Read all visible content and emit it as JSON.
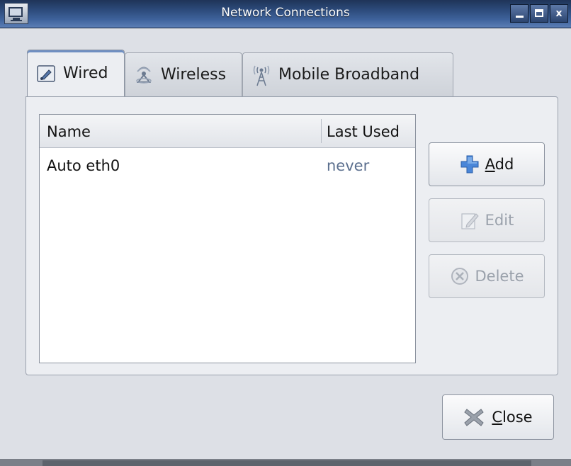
{
  "window": {
    "title": "Network Connections",
    "controls": {
      "minimize": "minimize",
      "maximize": "maximize",
      "close": "x"
    }
  },
  "tabs": [
    {
      "label": "Wired",
      "icon": "wired-icon",
      "active": true
    },
    {
      "label": "Wireless",
      "icon": "wireless-icon",
      "active": false
    },
    {
      "label": "Mobile Broadband",
      "icon": "antenna-icon",
      "active": false
    }
  ],
  "connections": {
    "columns": {
      "name": "Name",
      "last_used": "Last Used"
    },
    "rows": [
      {
        "name": "Auto eth0",
        "last_used": "never"
      }
    ]
  },
  "actions": {
    "add": {
      "label_mnemonic": "A",
      "label_rest": "dd",
      "icon": "plus-icon",
      "enabled": true
    },
    "edit": {
      "label": "Edit",
      "icon": "edit-icon",
      "enabled": false
    },
    "delete": {
      "label": "Delete",
      "icon": "delete-icon",
      "enabled": false
    }
  },
  "footer": {
    "close": {
      "label_mnemonic": "C",
      "label_rest": "lose",
      "icon": "close-x-icon"
    }
  },
  "colors": {
    "titlebar": "#2c4a7a",
    "accent_blue": "#4a86d8",
    "last_used_text": "#5b6f8e"
  }
}
